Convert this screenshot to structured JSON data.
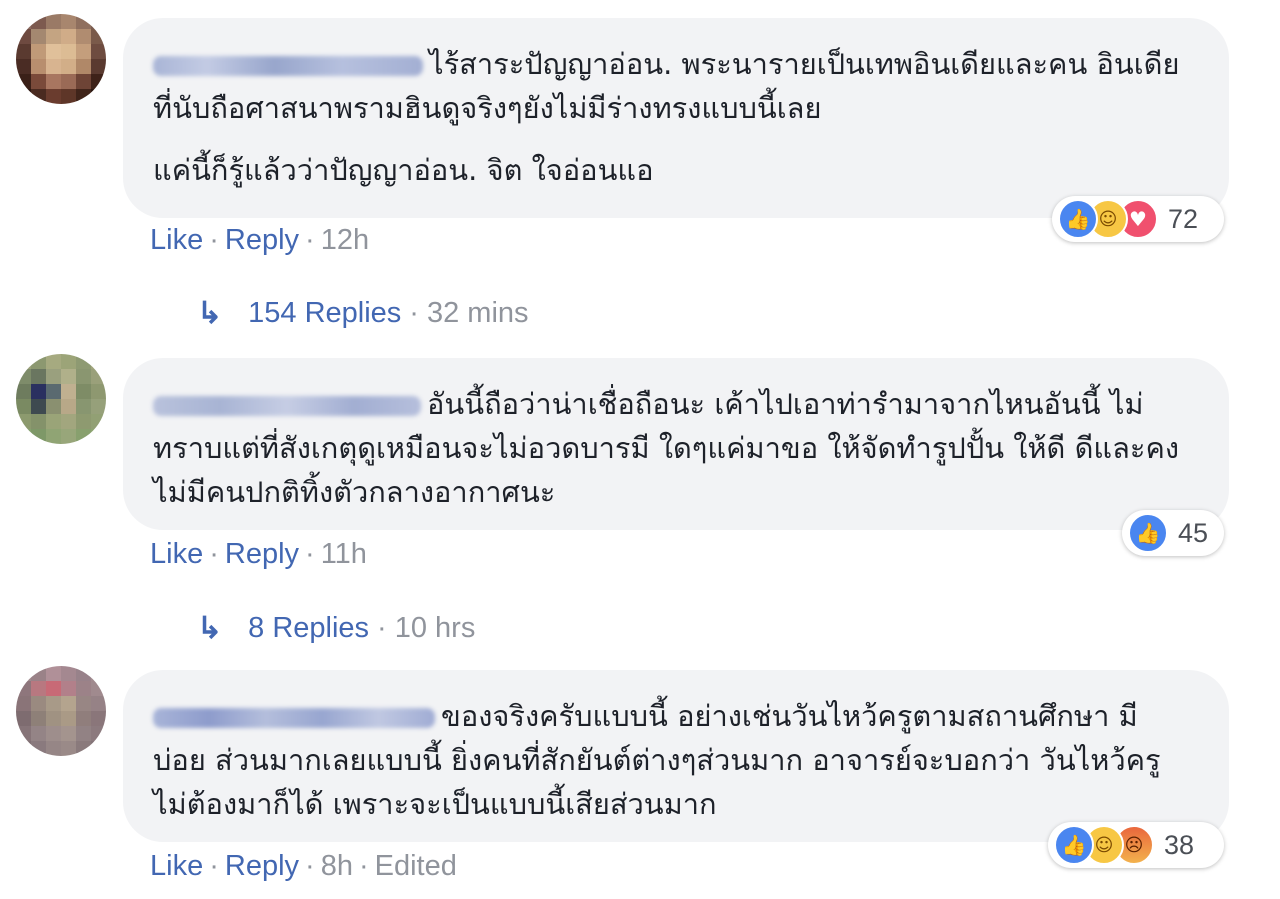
{
  "comments": [
    {
      "paragraphs": [
        "ไร้สาระปัญญาอ่อน. พระนารายเป็นเทพอินเดียและคน อินเดียที่นับถือศาสนาพรามฮินดูจริงๆยังไม่มีร่างทรงแบบนี้เลย",
        "แค่นี้ก็รู้แล้วว่าปัญญาอ่อน. จิต ใจอ่อนแอ"
      ],
      "reactions": [
        "like-icon",
        "haha-icon",
        "love-icon"
      ],
      "reaction_count": "72",
      "like_label": "Like",
      "reply_label": "Reply",
      "time": "12h",
      "replies_label": "154 Replies",
      "replies_time": "32 mins"
    },
    {
      "paragraphs": [
        "อันนี้ถือว่าน่าเชื่อถือนะ เค้าไปเอาท่ารำมาจากไหนอันนี้ ไม่ทราบแต่ที่สังเกตุดูเหมือนจะไม่อวดบารมี ใดๆแค่มาขอ ให้จัดทำรูปปั้น ให้ดี ดีและคงไม่มีคนปกติทิ้งตัวกลางอากาศนะ"
      ],
      "reactions": [
        "like-icon"
      ],
      "reaction_count": "45",
      "like_label": "Like",
      "reply_label": "Reply",
      "time": "11h",
      "replies_label": "8 Replies",
      "replies_time": "10 hrs"
    },
    {
      "paragraphs": [
        "ของจริงครับแบบนี้ อย่างเช่นวันไหว้ครูตามสถานศึกษา มีบ่อย ส่วนมากเลยแบบนี้ ยิ่งคนที่สักยันต์ต่างๆส่วนมาก อาจารย์จะบอกว่า วันไหว้ครูไม่ต้องมาก็ได้ เพราะจะเป็นแบบนี้เสียส่วนมาก"
      ],
      "reactions": [
        "like-icon",
        "haha-icon",
        "angry-icon"
      ],
      "reaction_count": "38",
      "like_label": "Like",
      "reply_label": "Reply",
      "time": "8h",
      "edited_label": "Edited"
    }
  ],
  "colors": {
    "link": "#4267b2",
    "meta": "#90949c",
    "bubble": "#f2f3f5",
    "text": "#1d2129"
  }
}
